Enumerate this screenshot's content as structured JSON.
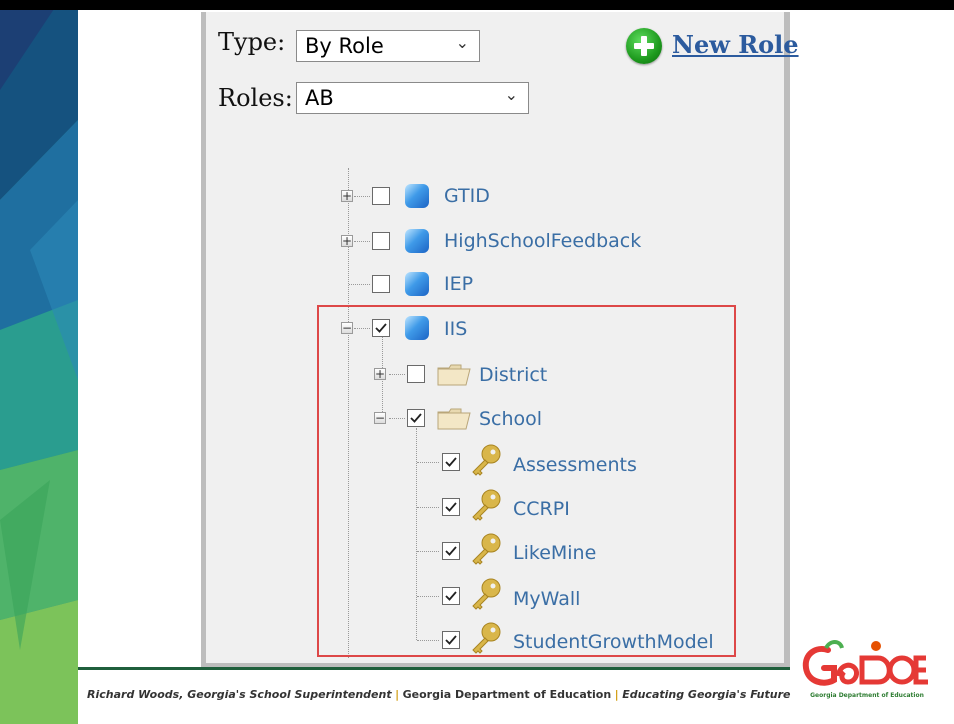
{
  "form": {
    "type_label": "Type:",
    "type_value": "By Role",
    "roles_label": "Roles:",
    "roles_value": "AB",
    "new_role_label": "New Role"
  },
  "tree": {
    "gtid": "GTID",
    "highschoolfeedback": "HighSchoolFeedback",
    "iep": "IEP",
    "iis": "IIS",
    "district": "District",
    "school": "School",
    "assessments": "Assessments",
    "ccrpi": "CCRPI",
    "likemine": "LikeMine",
    "mywall": "MyWall",
    "studentgrowthmodel": "StudentGrowthModel"
  },
  "footer": {
    "superintendent": "Richard Woods, Georgia's School Superintendent",
    "separator": "|",
    "department": "Georgia Department of Education",
    "tagline": "Educating Georgia's Future"
  },
  "logo": {
    "wordmark": "GaDOE",
    "subtitle": "Georgia Department of Education"
  },
  "colors": {
    "link": "#3a6ea5",
    "highlight_box": "#dd4848",
    "footer_separator": "#d4a017"
  },
  "icons": {
    "add": "green-plus-circle",
    "module": "blue-cube",
    "folder": "folder",
    "permission": "gold-key"
  }
}
